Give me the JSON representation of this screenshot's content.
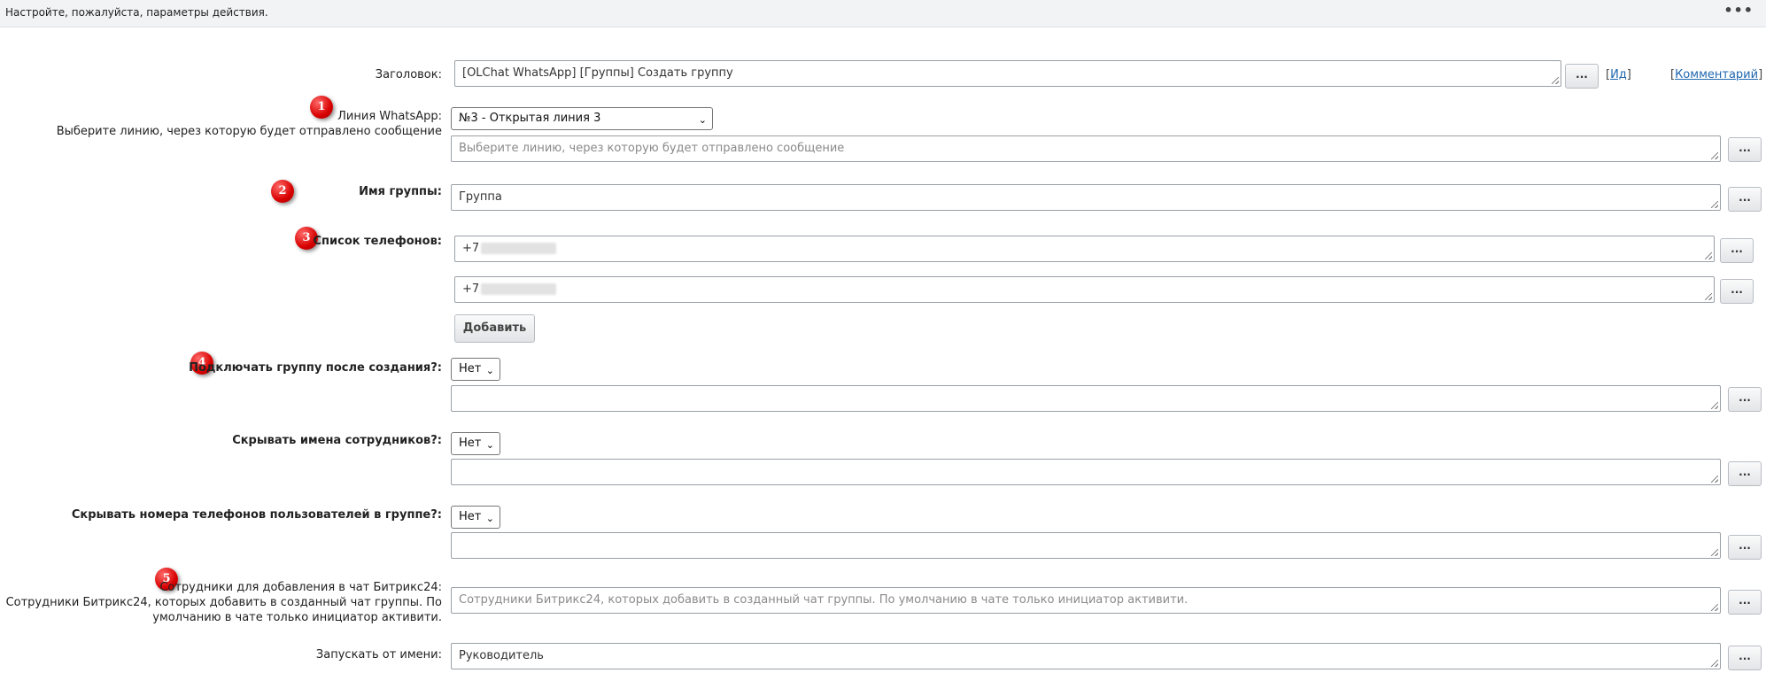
{
  "window": {
    "title": "Настройте, пожалуйста, параметры действия.",
    "menu_icon": "more-dots-icon"
  },
  "header_row": {
    "label": "Заголовок:",
    "value": "[OLChat WhatsApp] [Группы] Создать группу",
    "dots_label": "...",
    "id_link": "Ид",
    "comment_link": "Комментарий"
  },
  "line": {
    "badge": "1",
    "label": "Линия WhatsApp:",
    "sublabel": "Выберите линию, через которую будет отправлено сообщение",
    "selected": "№3 - Открытая линия 3",
    "placeholder": "Выберите линию, через которую будет отправлено сообщение",
    "dots_label": "..."
  },
  "group_name": {
    "badge": "2",
    "label": "Имя группы:",
    "value": "Группа",
    "dots_label": "..."
  },
  "phones": {
    "badge": "3",
    "label": "Список телефонов:",
    "items": [
      "+7",
      "+7"
    ],
    "dots_label": "...",
    "add_label": "Добавить"
  },
  "connect": {
    "badge": "4",
    "label": "Подключать группу после создания?:",
    "selected": "Нет",
    "dots_label": "..."
  },
  "hide_names": {
    "label": "Скрывать имена сотрудников?:",
    "selected": "Нет",
    "dots_label": "..."
  },
  "hide_phones": {
    "label": "Скрывать номера телефонов пользователей в группе?:",
    "selected": "Нет",
    "dots_label": "..."
  },
  "employees": {
    "badge": "5",
    "label": "Сотрудники для добавления в чат Битрикс24:",
    "sublabel_1": "Сотрудники Битрикс24, которых добавить в созданный чат группы. По",
    "sublabel_2": "умолчанию в чате только инициатор активити.",
    "placeholder": "Сотрудники Битрикс24, которых добавить в созданный чат группы. По умолчанию в чате только инициатор активити.",
    "dots_label": "..."
  },
  "run_as": {
    "label": "Запускать от имени:",
    "value": "Руководитель",
    "dots_label": "..."
  },
  "colors": {
    "badge": "#d80000",
    "link": "#2067b0",
    "topbar": "#f2f3f5"
  }
}
